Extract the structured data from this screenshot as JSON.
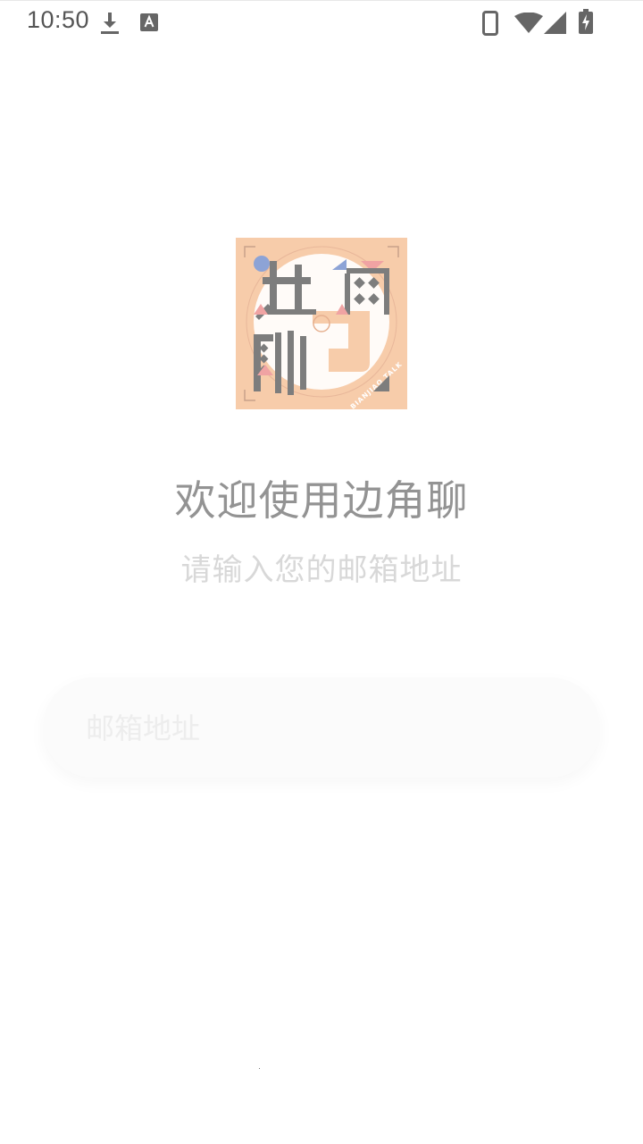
{
  "status_bar": {
    "time": "10:50",
    "icons": [
      "download-icon",
      "text-a-icon",
      "phone-icon",
      "wifi-icon",
      "signal-icon",
      "battery-charging-icon"
    ]
  },
  "logo": {
    "name": "边角聊 app logo",
    "text": "边角聊",
    "tagline": "BIANJIAO TALK",
    "bg_color": "#f7ccaa"
  },
  "welcome": {
    "title": "欢迎使用边角聊",
    "subtitle": "请输入您的邮箱地址"
  },
  "email": {
    "placeholder": "邮箱地址",
    "value": ""
  }
}
